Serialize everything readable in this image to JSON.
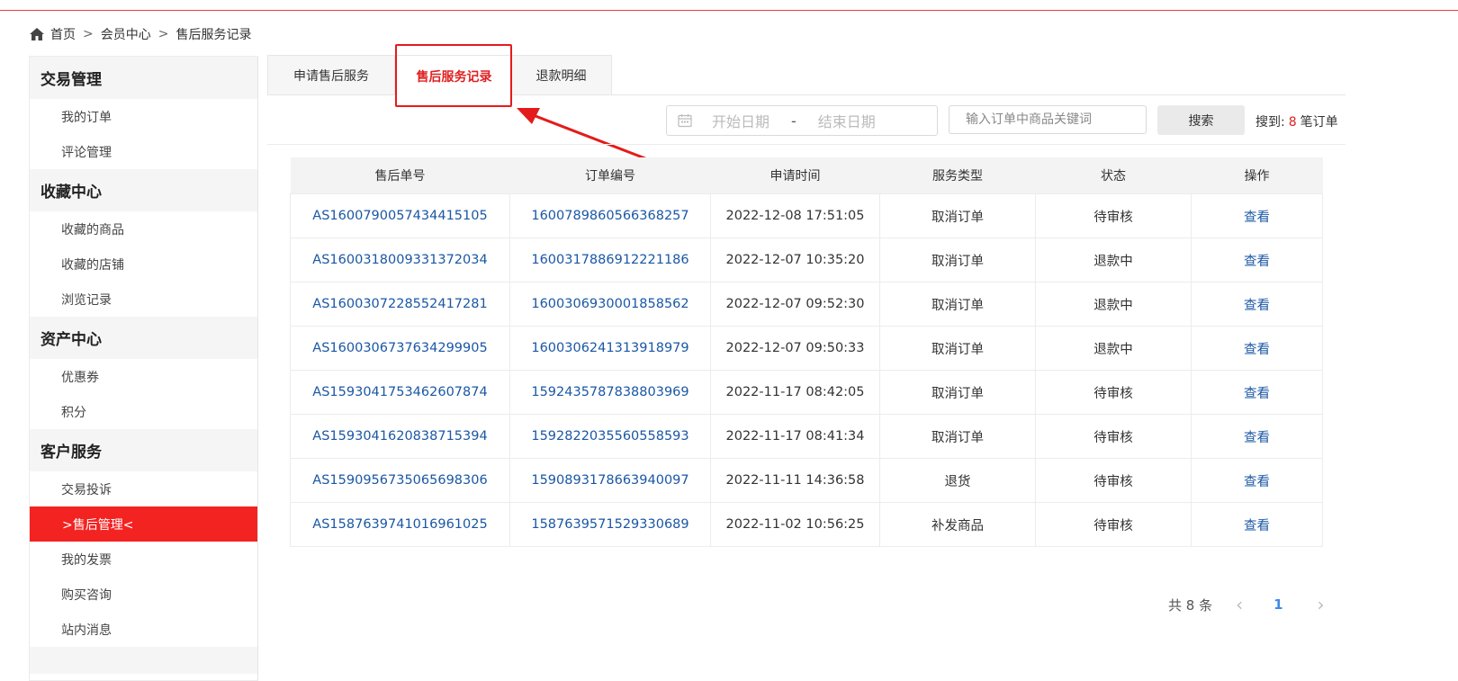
{
  "breadcrumb": {
    "items": [
      "首页",
      "会员中心",
      "售后服务记录"
    ],
    "separator": ">"
  },
  "sidebar": {
    "groups": [
      {
        "title": "交易管理",
        "items": [
          "我的订单",
          "评论管理"
        ]
      },
      {
        "title": "收藏中心",
        "items": [
          "收藏的商品",
          "收藏的店铺",
          "浏览记录"
        ]
      },
      {
        "title": "资产中心",
        "items": [
          "优惠券",
          "积分"
        ]
      },
      {
        "title": "客户服务",
        "items": [
          "交易投诉",
          ">售后管理<",
          "我的发票",
          "购买咨询",
          "站内消息"
        ]
      }
    ],
    "active_item": ">售后管理<"
  },
  "tabs": [
    {
      "label": "申请售后服务",
      "active": false
    },
    {
      "label": "售后服务记录",
      "active": true
    },
    {
      "label": "退款明细",
      "active": false
    }
  ],
  "filter": {
    "start_placeholder": "开始日期",
    "end_placeholder": "结束日期",
    "dash": "-",
    "keyword_placeholder": "输入订单中商品关键词",
    "search_label": "搜索",
    "found_prefix": "搜到:",
    "found_count": "8",
    "found_suffix": "笔订单"
  },
  "table": {
    "headers": [
      "售后单号",
      "订单编号",
      "申请时间",
      "服务类型",
      "状态",
      "操作"
    ],
    "rows": [
      [
        "AS1600790057434415105",
        "1600789860566368257",
        "2022-12-08 17:51:05",
        "取消订单",
        "待审核",
        "查看"
      ],
      [
        "AS1600318009331372034",
        "1600317886912221186",
        "2022-12-07 10:35:20",
        "取消订单",
        "退款中",
        "查看"
      ],
      [
        "AS1600307228552417281",
        "1600306930001858562",
        "2022-12-07 09:52:30",
        "取消订单",
        "退款中",
        "查看"
      ],
      [
        "AS1600306737634299905",
        "1600306241313918979",
        "2022-12-07 09:50:33",
        "取消订单",
        "退款中",
        "查看"
      ],
      [
        "AS1593041753462607874",
        "1592435787838803969",
        "2022-11-17 08:42:05",
        "取消订单",
        "待审核",
        "查看"
      ],
      [
        "AS1593041620838715394",
        "1592822035560558593",
        "2022-11-17 08:41:34",
        "取消订单",
        "待审核",
        "查看"
      ],
      [
        "AS1590956735065698306",
        "1590893178663940097",
        "2022-11-11 14:36:58",
        "退货",
        "待审核",
        "查看"
      ],
      [
        "AS1587639741016961025",
        "1587639571529330689",
        "2022-11-02 10:56:25",
        "补发商品",
        "待审核",
        "查看"
      ]
    ]
  },
  "pagination": {
    "total_text": "共 8 条",
    "current_page": "1",
    "prev": "‹",
    "next": "›"
  },
  "colors": {
    "accent_red": "#f32322",
    "link_blue": "#1a57a5",
    "page_blue": "#3f8be6"
  }
}
